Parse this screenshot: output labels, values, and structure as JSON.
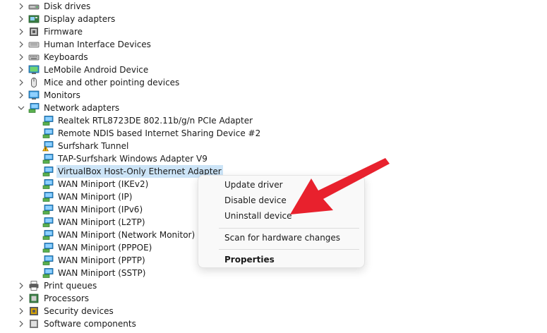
{
  "tree": {
    "categories_top": [
      {
        "label": "Disk drives",
        "icon": "disk-drive-icon"
      },
      {
        "label": "Display adapters",
        "icon": "display-adapter-icon"
      },
      {
        "label": "Firmware",
        "icon": "firmware-icon"
      },
      {
        "label": "Human Interface Devices",
        "icon": "hid-icon"
      },
      {
        "label": "Keyboards",
        "icon": "keyboard-icon"
      },
      {
        "label": "LeMobile Android Device",
        "icon": "android-device-icon"
      },
      {
        "label": "Mice and other pointing devices",
        "icon": "mouse-icon"
      },
      {
        "label": "Monitors",
        "icon": "monitor-icon"
      }
    ],
    "network_adapters": {
      "label": "Network adapters",
      "icon": "network-adapter-icon",
      "expanded": true,
      "children": [
        {
          "label": "Realtek RTL8723DE 802.11b/g/n PCIe Adapter",
          "warning": false
        },
        {
          "label": "Remote NDIS based Internet Sharing Device #2",
          "warning": false
        },
        {
          "label": "Surfshark Tunnel",
          "warning": true
        },
        {
          "label": "TAP-Surfshark Windows Adapter V9",
          "warning": false
        },
        {
          "label": "VirtualBox Host-Only Ethernet Adapter",
          "warning": false,
          "selected": true
        },
        {
          "label": "WAN Miniport (IKEv2)",
          "warning": false
        },
        {
          "label": "WAN Miniport (IP)",
          "warning": false
        },
        {
          "label": "WAN Miniport (IPv6)",
          "warning": false
        },
        {
          "label": "WAN Miniport (L2TP)",
          "warning": false
        },
        {
          "label": "WAN Miniport (Network Monitor)",
          "warning": false
        },
        {
          "label": "WAN Miniport (PPPOE)",
          "warning": false
        },
        {
          "label": "WAN Miniport (PPTP)",
          "warning": false
        },
        {
          "label": "WAN Miniport (SSTP)",
          "warning": false
        }
      ]
    },
    "categories_bottom": [
      {
        "label": "Print queues",
        "icon": "printer-icon"
      },
      {
        "label": "Processors",
        "icon": "processor-icon"
      },
      {
        "label": "Security devices",
        "icon": "security-device-icon"
      },
      {
        "label": "Software components",
        "icon": "software-component-icon"
      }
    ]
  },
  "context_menu": {
    "update_driver": "Update driver",
    "disable_device": "Disable device",
    "uninstall_device": "Uninstall device",
    "scan_hardware": "Scan for hardware changes",
    "properties": "Properties"
  },
  "colors": {
    "selection": "#cce4f7",
    "annotation_arrow": "#e8212d",
    "network_icon": "#2b8fd6",
    "warning": "#f5b400"
  }
}
